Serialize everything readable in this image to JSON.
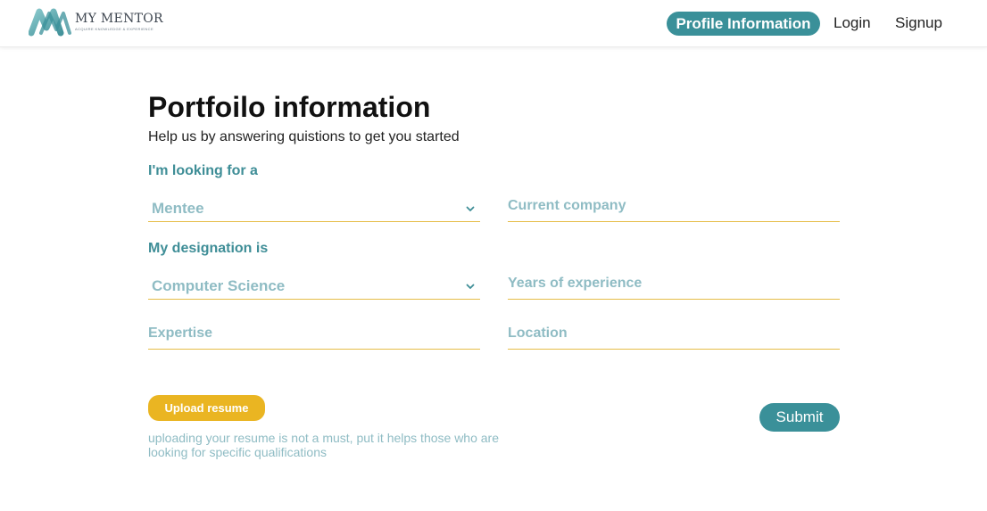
{
  "brand": {
    "name": "MY MENTOR",
    "tagline": "ACQUIRE KNOWLEDGE & EXPERIENCE"
  },
  "nav": {
    "profile": "Profile Information",
    "login": "Login",
    "signup": "Signup"
  },
  "page": {
    "title": "Portfoilo information",
    "subtitle": "Help us by answering quistions to get you started"
  },
  "form": {
    "looking_label": "I'm looking for a",
    "looking_value": "Mentee",
    "company_placeholder": "Current company",
    "designation_label": "My designation is",
    "designation_value": "Computer Science",
    "years_placeholder": "Years of experience",
    "expertise_placeholder": "Expertise",
    "location_placeholder": "Location",
    "upload_label": "Upload resume",
    "upload_note": "uploading your resume is not a must, put it helps those who are looking for specific qualifications",
    "submit_label": "Submit"
  },
  "colors": {
    "teal": "#3a9099",
    "label_teal": "#3f8e97",
    "muted_teal": "#8fbcc4",
    "yellow": "#eab522",
    "underline": "#e6bd47"
  },
  "icons": {
    "logo": "mm-logo-icon",
    "dropdown": "chevron-down-icon"
  }
}
